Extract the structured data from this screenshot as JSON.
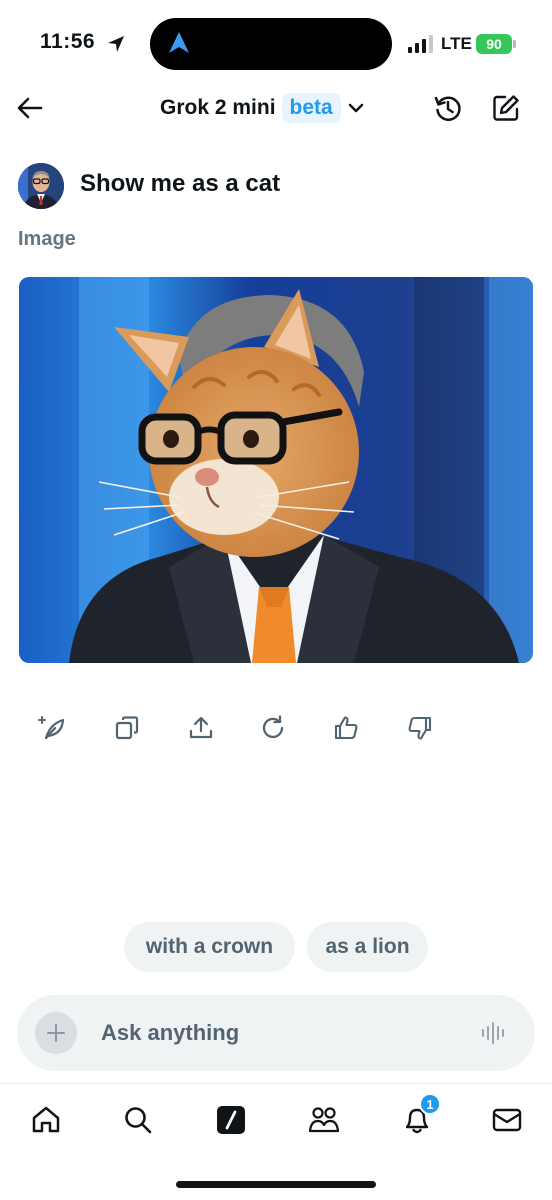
{
  "status_bar": {
    "time": "11:56",
    "network": "LTE",
    "battery": "90",
    "battery_color": "#34c759"
  },
  "header": {
    "model_name": "Grok 2 mini",
    "badge": "beta",
    "accent_color": "#1d9bf0",
    "icons": [
      "back-arrow-icon",
      "chevron-down-icon",
      "history-icon",
      "compose-icon"
    ]
  },
  "conversation": {
    "user_message": "Show me as a cat",
    "response_label": "Image",
    "actions": [
      "regenerate-sparkle-icon",
      "copy-icon",
      "share-icon",
      "refresh-icon",
      "thumbs-up-icon",
      "thumbs-down-icon"
    ]
  },
  "suggestions": [
    "with a crown",
    "as a lion"
  ],
  "input": {
    "placeholder": "Ask anything"
  },
  "tab_bar": {
    "items": [
      "home-icon",
      "search-icon",
      "grok-icon",
      "communities-icon",
      "notifications-icon",
      "messages-icon"
    ],
    "notification_count": "1"
  }
}
